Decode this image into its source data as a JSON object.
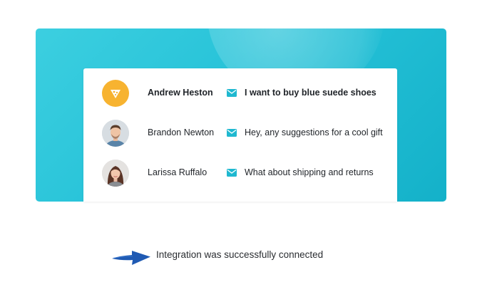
{
  "colors": {
    "banner": "#26c2d8",
    "brand_avatar": "#f7b330",
    "mail_icon": "#1fb8d0",
    "arrow": "#1f5ab3"
  },
  "conversations": [
    {
      "name": "Andrew Heston",
      "message": "I want to buy blue suede shoes",
      "unread": true,
      "avatar_icon": "brand-logo-icon"
    },
    {
      "name": "Brandon Newton",
      "message": "Hey, any suggestions for a cool gift",
      "unread": false,
      "avatar_icon": "avatar"
    },
    {
      "name": "Larissa Ruffalo",
      "message": "What about shipping and returns",
      "unread": false,
      "avatar_icon": "avatar"
    }
  ],
  "status": {
    "text": "Integration was successfully connected",
    "icon": "arrow-right-icon"
  }
}
